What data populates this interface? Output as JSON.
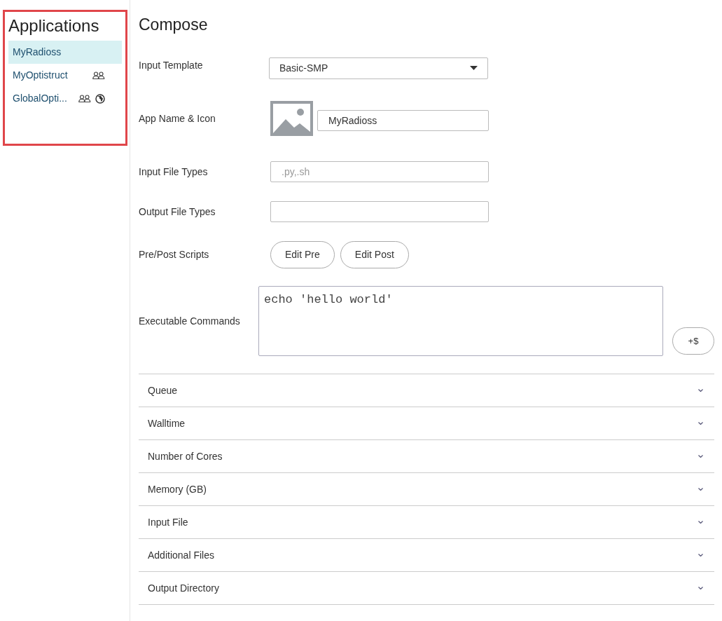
{
  "sidebar": {
    "title": "Applications",
    "items": [
      {
        "label": "MyRadioss",
        "selected": true,
        "shared": false,
        "global": false
      },
      {
        "label": "MyOptistruct",
        "selected": false,
        "shared": true,
        "global": false
      },
      {
        "label": "GlobalOpti...",
        "selected": false,
        "shared": true,
        "global": true
      }
    ]
  },
  "compose": {
    "title": "Compose",
    "input_template": {
      "label": "Input Template",
      "value": "Basic-SMP"
    },
    "app_name": {
      "label": "App Name & Icon",
      "value": "MyRadioss"
    },
    "input_file_types": {
      "label": "Input File Types",
      "placeholder": ".py,.sh"
    },
    "output_file_types": {
      "label": "Output File Types"
    },
    "scripts": {
      "label": "Pre/Post Scripts",
      "buttons": [
        "Edit Pre",
        "Edit Post"
      ]
    },
    "commands": {
      "label": "Executable Commands",
      "value": "echo 'hello world'",
      "button": "+$"
    },
    "sections": [
      {
        "label": "Queue",
        "expanded": false
      },
      {
        "label": "Walltime",
        "expanded": false
      },
      {
        "label": "Number of Cores",
        "expanded": false
      },
      {
        "label": "Memory (GB)",
        "expanded": false
      },
      {
        "label": "Input File",
        "expanded": false
      },
      {
        "label": "Additional Files",
        "expanded": false
      },
      {
        "label": "Output Directory",
        "expanded": false
      }
    ]
  }
}
